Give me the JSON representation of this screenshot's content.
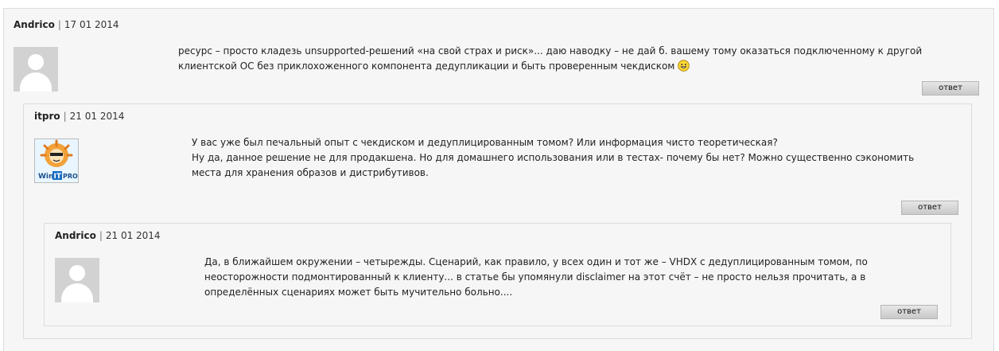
{
  "comments": [
    {
      "author": "Andrico",
      "date": "17 01 2014",
      "text_line1": "ресурс – просто кладезь unsupported-решений «на свой страх и риск»... даю наводку – не дай б. вашему тому оказаться подключенному к другой",
      "text_line2": "клиентской ОС без приклохоженного компонента дедупликации и быть проверенным чекдиском",
      "reply_label": "ответ",
      "avatar_icon": "default-user-icon"
    },
    {
      "author": "itpro",
      "date": "21 01 2014",
      "text_line1": "У вас уже был печальный опыт с чекдиском и дедуплицированным томом?  Или информация чисто теоретическая?",
      "text_line2": "Ну да, данное решение не для продакшена. Но для домашнего использования или в тестах- почему бы нет?  Можно существенно сэкономить",
      "text_line3": "места для хранения образов и дистрибутивов.",
      "reply_label": "ответ",
      "avatar_icon": "winitpro-logo-icon",
      "avatar_logo_text_1": "Win",
      "avatar_logo_text_2": "IT",
      "avatar_logo_text_3": "PRO"
    },
    {
      "author": "Andrico",
      "date": "21 01 2014",
      "text_line1": "Да, в ближайшем окружении – четырежды. Сценарий, как правило, у всех один и тот же – VHDX с дедуплицированным томом, по",
      "text_line2": "неосторожности подмонтированный к клиенту... в статье бы упомянули disclaimer на этот счёт – не просто нельзя прочитать, а в",
      "text_line3": "определённых сценариях может быть мучительно больно....",
      "reply_label": "ответ",
      "avatar_icon": "default-user-icon"
    }
  ],
  "separator": "|",
  "colors": {
    "panel_bg": "#f6f6f6",
    "panel_border": "#dcdcdc",
    "avatar_gray": "#d2d2d2"
  }
}
